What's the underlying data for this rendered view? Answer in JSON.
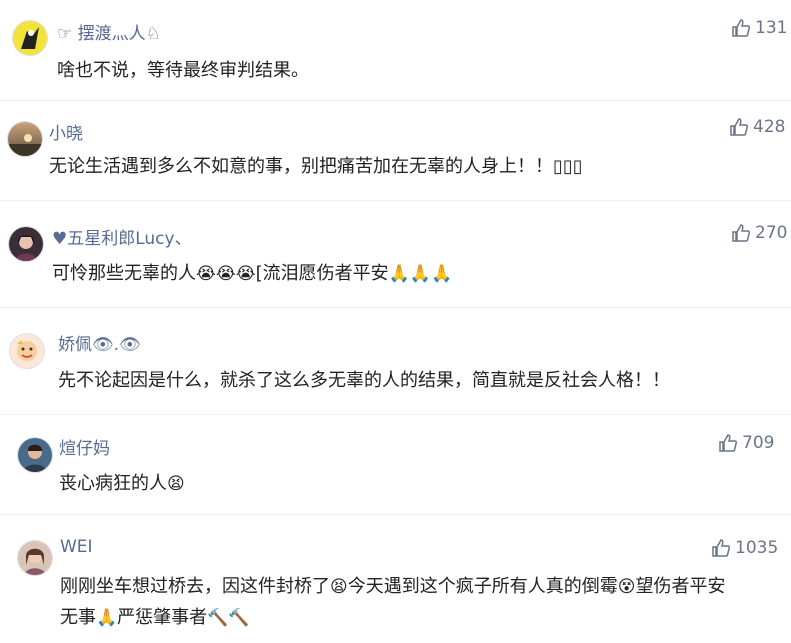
{
  "comments": [
    {
      "user": "☞ 摆渡灬人♘",
      "text": "啥也不说，等待最终审判结果。",
      "likes": "131"
    },
    {
      "user": "小晓",
      "text": "无论生活遇到多么不如意的事，别把痛苦加在无辜的人身上！！▯▯▯",
      "likes": "428"
    },
    {
      "user": "♥五星利郎Lucy、",
      "text_a": "可怜那些无辜的人",
      "text_b": "[流泪愿伤者平安",
      "likes": "270"
    },
    {
      "user": "娇佩👁.👁",
      "text": "先不论起因是什么，就杀了这么多无辜的人的结果，简直就是反社会人格！！",
      "likes": ""
    },
    {
      "user": "煊仔妈",
      "text": "丧心病狂的人",
      "likes": "709"
    },
    {
      "user": "WEI",
      "text_a": "刚刚坐车想过桥去，因这件封桥了",
      "text_b": "今天遇到这个疯子所有人真的倒霉",
      "text_c": "望伤者平安",
      "text_d": "无事",
      "text_e": "严惩肇事者",
      "likes": "1035"
    }
  ],
  "icons": {
    "like": "thumbs-up-icon",
    "accent": "#576b95"
  }
}
